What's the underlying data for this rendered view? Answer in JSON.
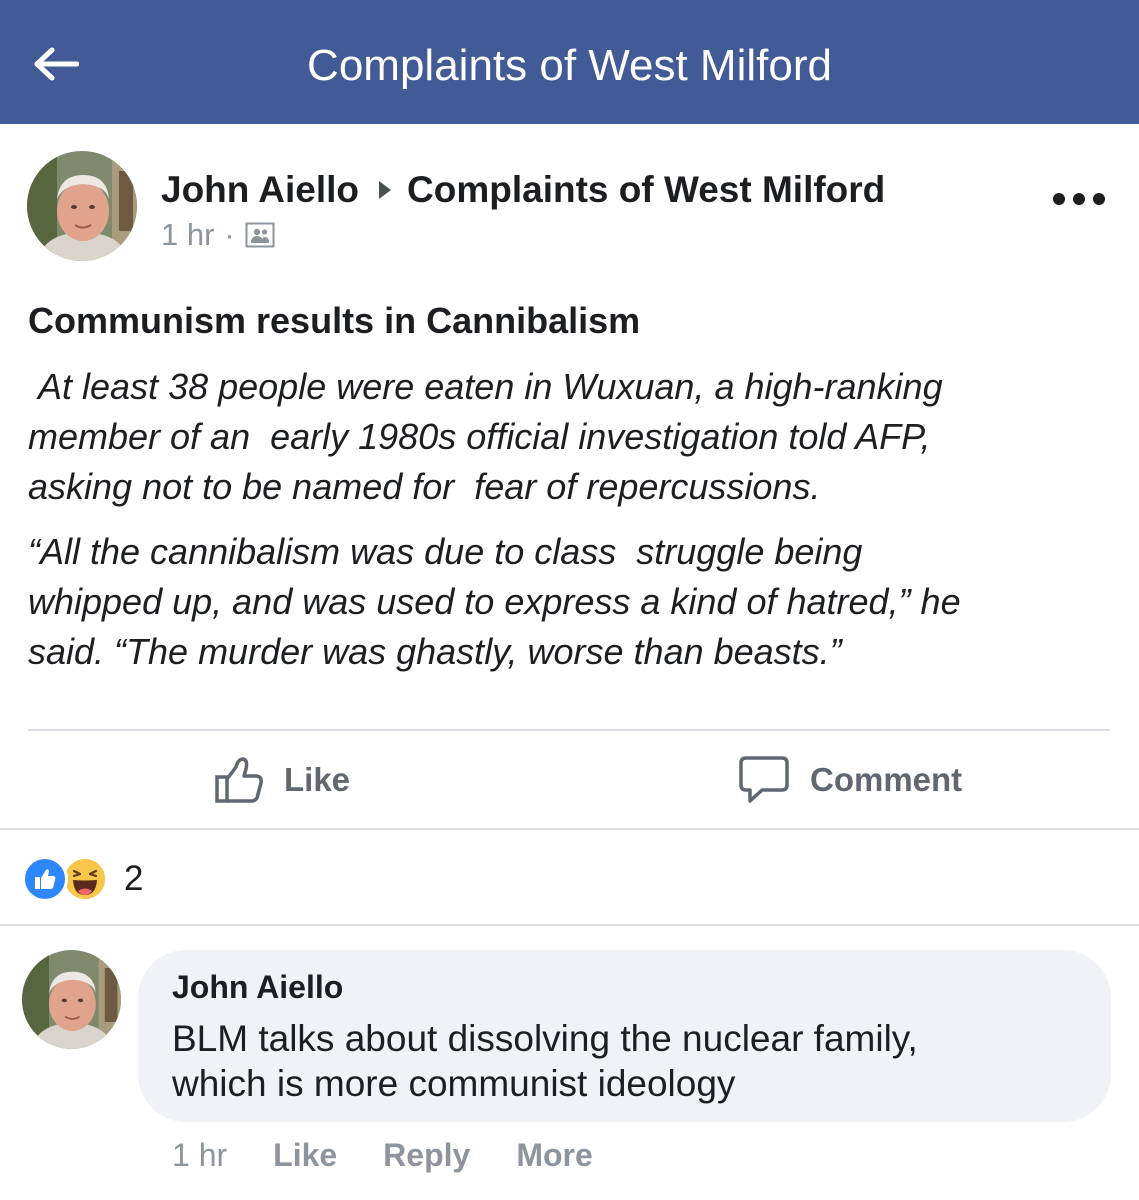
{
  "header": {
    "title": "Complaints of West Milford",
    "back_icon": "arrow-left-icon",
    "background_color": "#425b96"
  },
  "post": {
    "author": "John Aiello",
    "group": "Complaints of West Milford",
    "time": "1 hr",
    "meta_separator": "·",
    "privacy_icon": "group-members-icon",
    "menu_icon": "more-horizontal-icon",
    "title": "Communism results in Cannibalism",
    "quote_paragraphs": [
      " At least 38 people were eaten in Wuxuan, a high-ranking\nmember of an  early 1980s official investigation told AFP,\nasking not to be named for  fear of repercussions.",
      "“All the cannibalism was due to class  struggle being\nwhipped up, and was used to express a kind of hatred,” he\nsaid. “The murder was ghastly, worse than beasts.”"
    ]
  },
  "actions": {
    "like_label": "Like",
    "like_icon": "thumbs-up-outline-icon",
    "comment_label": "Comment",
    "comment_icon": "speech-bubble-icon"
  },
  "reactions": {
    "icons": [
      "like-reaction-icon",
      "haha-reaction-icon"
    ],
    "count": "2"
  },
  "comment": {
    "author": "John Aiello",
    "text": "BLM talks about dissolving the nuclear family,\nwhich is more communist ideology",
    "time": "1 hr",
    "like_label": "Like",
    "reply_label": "Reply",
    "more_label": "More"
  }
}
